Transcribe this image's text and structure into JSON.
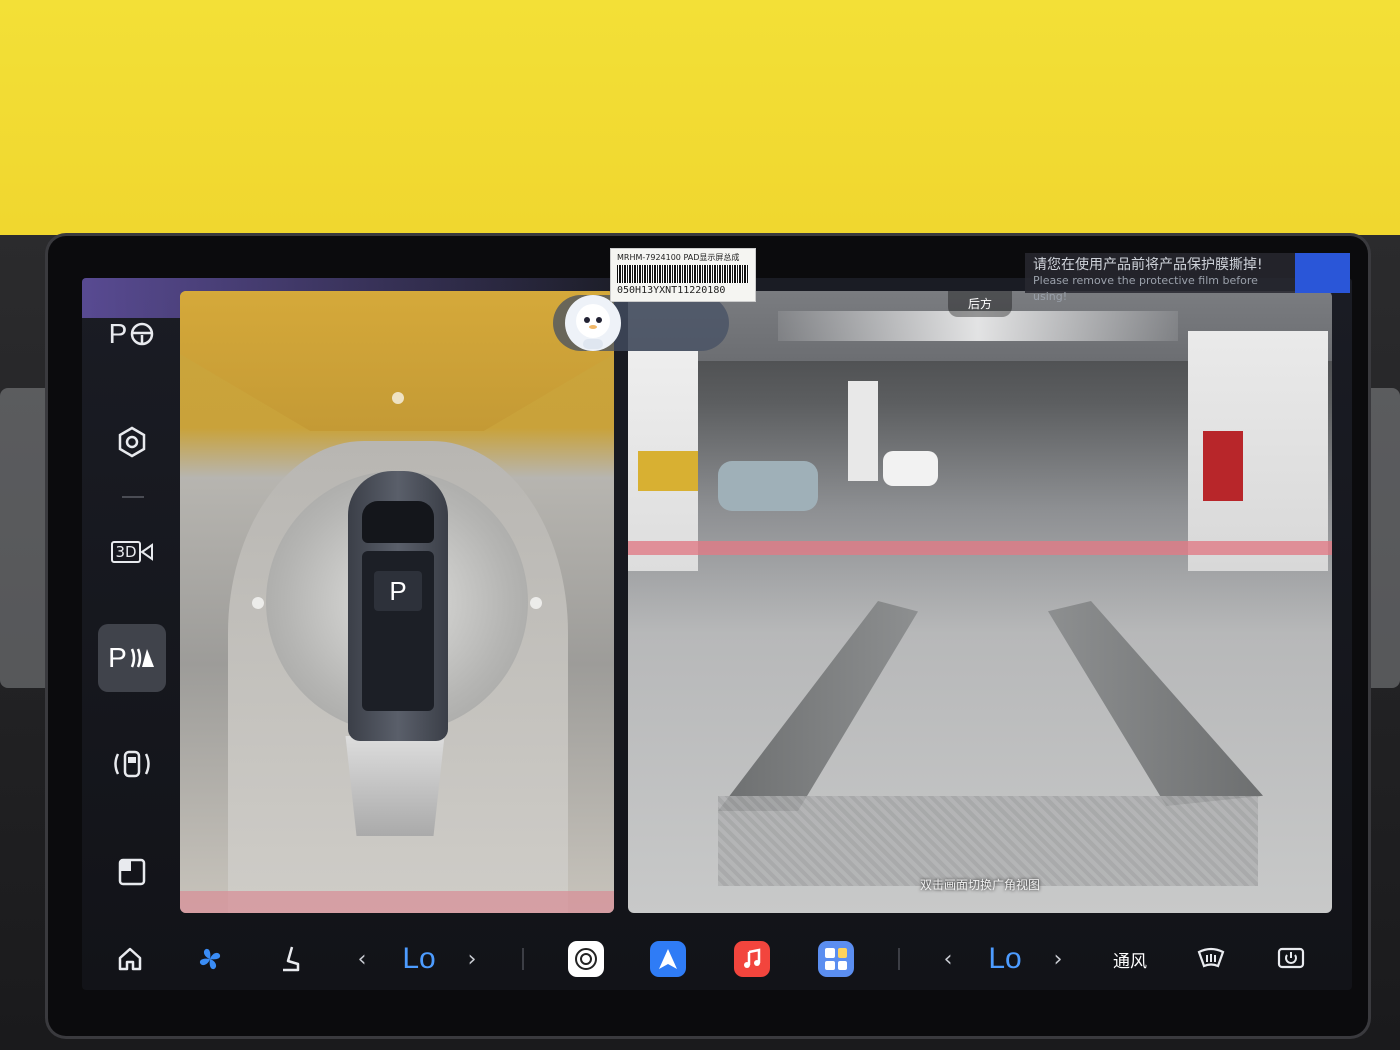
{
  "sidebar": {
    "items": [
      {
        "label": "P",
        "icon": "parking-steering-icon"
      },
      {
        "icon": "camera-hexagon-icon"
      },
      {
        "label": "3D",
        "icon": "3d-camera-icon"
      },
      {
        "label": "P",
        "icon": "parking-radar-icon",
        "active": true
      },
      {
        "icon": "car-sensor-icon"
      },
      {
        "icon": "split-view-icon"
      }
    ]
  },
  "views": {
    "gear_badge": "P",
    "rear_label": "后方",
    "rear_hint": "双击画面切换广角视图"
  },
  "sticker": {
    "line1": "MRHM-7924100 PAD显示屏总成",
    "serial": "050H13YXNT11220180"
  },
  "warning": {
    "zh": "请您在使用产品前将产品保护膜撕掉!",
    "en": "Please remove the protective film before using!"
  },
  "dock": {
    "left_temp": "Lo",
    "right_temp": "Lo",
    "vent_label": "通风",
    "icons": [
      "home-icon",
      "fan-icon",
      "seat-heat-icon",
      "chevron-left-icon",
      "chevron-right-icon",
      "app-store-icon",
      "navigation-app-icon",
      "music-app-icon",
      "app-grid-icon",
      "chevron-left-icon",
      "chevron-right-icon",
      "rear-defrost-icon",
      "power-icon"
    ]
  },
  "colors": {
    "accent": "#4d9cff",
    "active_bg": "#40434b",
    "screen_bg": "#15161c",
    "music": "#f2453d",
    "nav": "#2f7cf6"
  }
}
